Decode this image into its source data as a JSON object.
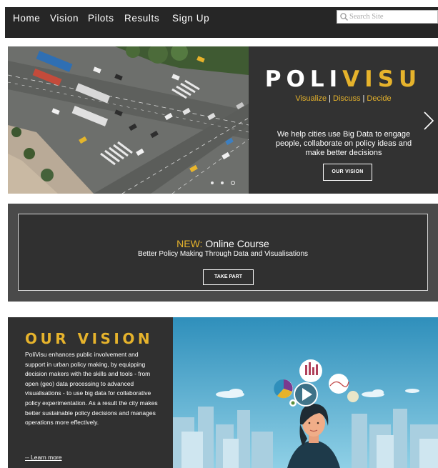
{
  "nav": {
    "items": [
      "Home",
      "Vision",
      "Pilots",
      "Results",
      "Sign Up"
    ],
    "search_placeholder": "Search Site"
  },
  "hero": {
    "brand_part1": "POLI",
    "brand_part2": "VISU",
    "tagline": [
      "Visualize",
      "Discuss",
      "Decide"
    ],
    "tagline_separator": "|",
    "description": "We help cities use Big Data to engage people, collaborate on policy ideas and make better decisions",
    "button": "OUR VISION",
    "slide_count": 3,
    "active_slide": 3
  },
  "course": {
    "new_label": "NEW:",
    "title": "Online Course",
    "subtitle": "Better Policy Making Through Data and Visualisations",
    "button": "TAKE PART"
  },
  "vision": {
    "title": "OUR VISION",
    "body": "PoliVisu enhances public involvement and support in urban policy making, by equipping decision makers with the skills and tools - from open (geo) data processing to advanced visualisations -  to use big data for collaborative policy experimentation. As a result the city makes better sustainable policy decisions and manages operations  more effectively.",
    "learn_more": "-- Learn more"
  },
  "colors": {
    "accent": "#e6b32c",
    "dark": "#303030",
    "nav_bg": "#262626",
    "sky": "#4aa4c4"
  },
  "icons": {
    "search": "magnifier-icon",
    "next": "chevron-right-icon",
    "play": "play-icon"
  }
}
